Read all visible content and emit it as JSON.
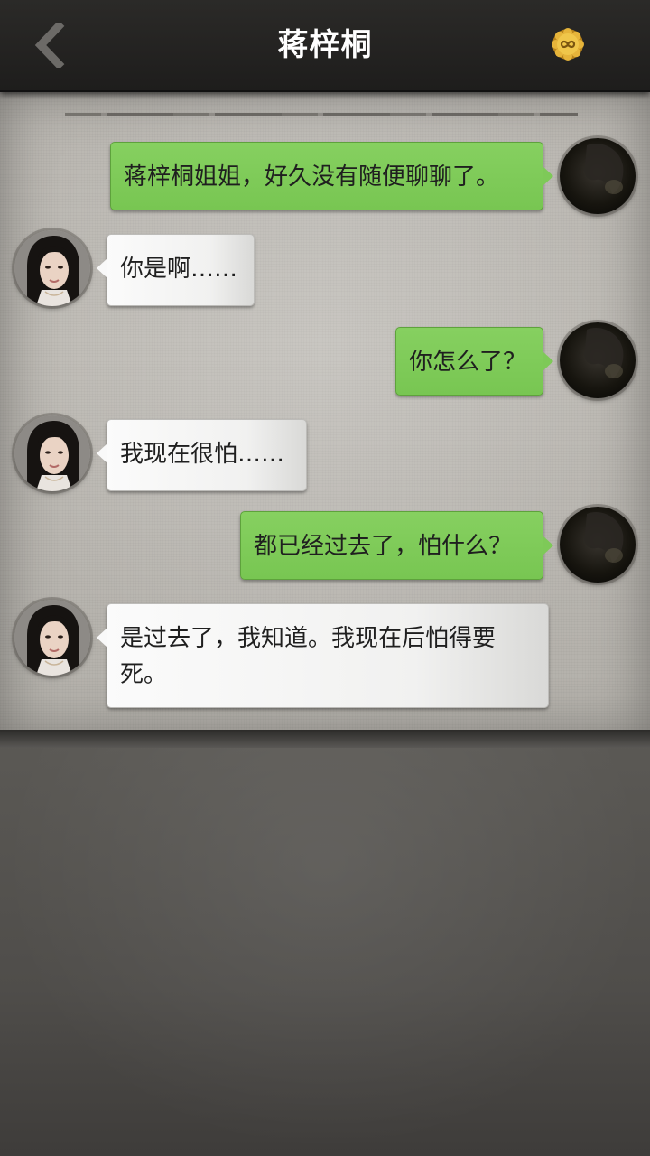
{
  "header": {
    "title": "蒋梓桐",
    "back_icon": "chevron-left-icon",
    "badge_icon": "infinity-badge-icon",
    "badge_color": "#d9a531"
  },
  "colors": {
    "sent_bubble": "#7ec958",
    "received_bubble": "#f4f4f3",
    "top_bar": "#252422"
  },
  "messages": [
    {
      "sender": "me",
      "text": "蒋梓桐姐姐，好久没有随便聊聊了。"
    },
    {
      "sender": "them",
      "text": "你是啊……"
    },
    {
      "sender": "me",
      "text": "你怎么了？"
    },
    {
      "sender": "them",
      "text": "我现在很怕……"
    },
    {
      "sender": "me",
      "text": "都已经过去了，怕什么？"
    },
    {
      "sender": "them",
      "text": "是过去了，我知道。我现在后怕得要死。"
    }
  ]
}
